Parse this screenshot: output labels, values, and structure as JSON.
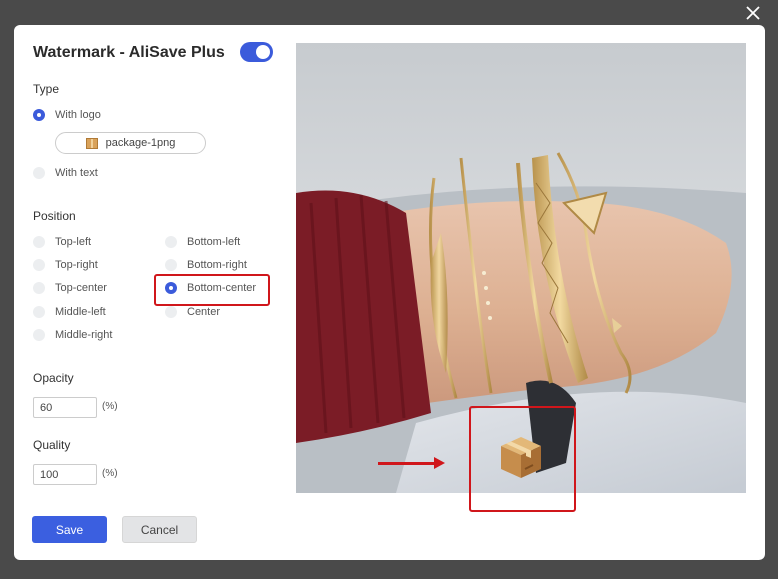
{
  "modal": {
    "title": "Watermark - AliSave Plus",
    "enabled": true,
    "close_icon": "close-icon"
  },
  "type": {
    "label": "Type",
    "options": [
      {
        "label": "With logo",
        "checked": true
      },
      {
        "label": "With text",
        "checked": false
      }
    ],
    "logo_file": "package-1png",
    "logo_icon": "package-icon"
  },
  "position": {
    "label": "Position",
    "left_column": [
      "Top-left",
      "Top-right",
      "Top-center",
      "Middle-left",
      "Middle-right"
    ],
    "right_column": [
      "Bottom-left",
      "Bottom-right",
      "Bottom-center",
      "Center"
    ],
    "selected": "Bottom-center"
  },
  "opacity": {
    "label": "Opacity",
    "value": "60",
    "unit": "(%)"
  },
  "quality": {
    "label": "Quality",
    "value": "100",
    "unit": "(%)"
  },
  "buttons": {
    "save": "Save",
    "cancel": "Cancel"
  },
  "preview": {
    "image": "bracelet-wrist-photo",
    "watermark_icon": "package-icon",
    "arrow_icon": "arrow-right-icon"
  },
  "colors": {
    "accent": "#3b5bdb",
    "highlight": "#d0161b"
  }
}
